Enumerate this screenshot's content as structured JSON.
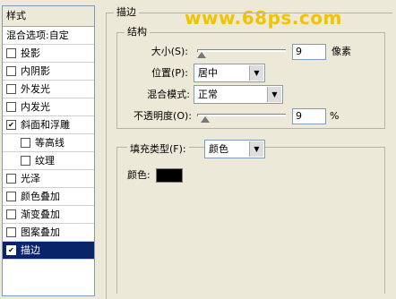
{
  "sidebar": {
    "header": "样式",
    "items": [
      {
        "label": "混合选项:自定",
        "checkbox": false,
        "checked": false,
        "sub": false
      },
      {
        "label": "投影",
        "checkbox": true,
        "checked": false,
        "sub": false
      },
      {
        "label": "内阴影",
        "checkbox": true,
        "checked": false,
        "sub": false
      },
      {
        "label": "外发光",
        "checkbox": true,
        "checked": false,
        "sub": false
      },
      {
        "label": "内发光",
        "checkbox": true,
        "checked": false,
        "sub": false
      },
      {
        "label": "斜面和浮雕",
        "checkbox": true,
        "checked": true,
        "sub": false
      },
      {
        "label": "等高线",
        "checkbox": true,
        "checked": false,
        "sub": true
      },
      {
        "label": "纹理",
        "checkbox": true,
        "checked": false,
        "sub": true
      },
      {
        "label": "光泽",
        "checkbox": true,
        "checked": false,
        "sub": false
      },
      {
        "label": "颜色叠加",
        "checkbox": true,
        "checked": false,
        "sub": false
      },
      {
        "label": "渐变叠加",
        "checkbox": true,
        "checked": false,
        "sub": false
      },
      {
        "label": "图案叠加",
        "checkbox": true,
        "checked": false,
        "sub": false
      },
      {
        "label": "描边",
        "checkbox": true,
        "checked": true,
        "sub": false,
        "selected": true
      }
    ]
  },
  "watermark": "www.68ps.com",
  "stroke": {
    "title": "描边",
    "structure_title": "结构",
    "size_label": "大小(S):",
    "size_value": "9",
    "size_unit": "像素",
    "size_fraction": 0.05,
    "position_label": "位置(P):",
    "position_value": "居中",
    "blend_label": "混合模式:",
    "blend_value": "正常",
    "opacity_label": "不透明度(O):",
    "opacity_value": "9",
    "opacity_unit": "%",
    "opacity_fraction": 0.09,
    "fill_type_label": "填充类型(F):",
    "fill_type_value": "颜色",
    "color_label": "颜色:",
    "color_value": "#000000"
  }
}
